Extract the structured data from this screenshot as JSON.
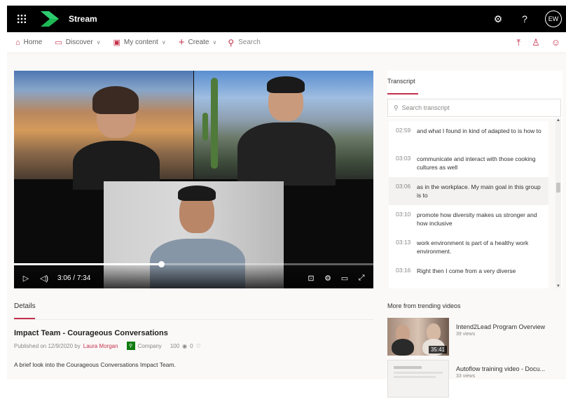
{
  "header": {
    "app_name": "Stream",
    "avatar_initials": "EW",
    "settings_icon": "gear-icon",
    "help_label": "?"
  },
  "nav": {
    "home": "Home",
    "discover": "Discover",
    "my_content": "My content",
    "create": "Create",
    "search_placeholder": "Search"
  },
  "video": {
    "current_time": "3:06",
    "separator": "/",
    "duration": "7:34",
    "progress": 0.41
  },
  "details": {
    "tab_label": "Details",
    "title": "Impact Team - Courageous Conversations",
    "published_prefix": "Published on 12/9/2020 by",
    "author": "Laura Morgan",
    "audience": "Company",
    "views": "100",
    "likes": "0",
    "description": "A brief look into the Courageous Conversations Impact Team."
  },
  "transcript": {
    "title": "Transcript",
    "search_placeholder": "Search transcript",
    "entries": [
      {
        "time": "02:59",
        "text": "and what I found in kind of adapted to is how to"
      },
      {
        "time": "03:03",
        "text": "communicate and interact with those cooking cultures as well"
      },
      {
        "time": "03:06",
        "text": "as in the workplace. My main goal in this group is to"
      },
      {
        "time": "03:10",
        "text": "promote how diversity makes us stronger and how inclusive"
      },
      {
        "time": "03:13",
        "text": "work environment is part of a healthy work environment."
      },
      {
        "time": "03:16",
        "text": "Right then I come from a very diverse"
      }
    ]
  },
  "trending": {
    "title": "More from trending videos",
    "items": [
      {
        "name": "Intend2Lead Program Overview",
        "views": "39 views",
        "duration": "35:41"
      },
      {
        "name": "Autoflow training video - Docu...",
        "views": "33 views",
        "duration": ""
      }
    ]
  },
  "colors": {
    "accent": "#c4314b",
    "topbar": "#000000",
    "company": "#107c10"
  }
}
